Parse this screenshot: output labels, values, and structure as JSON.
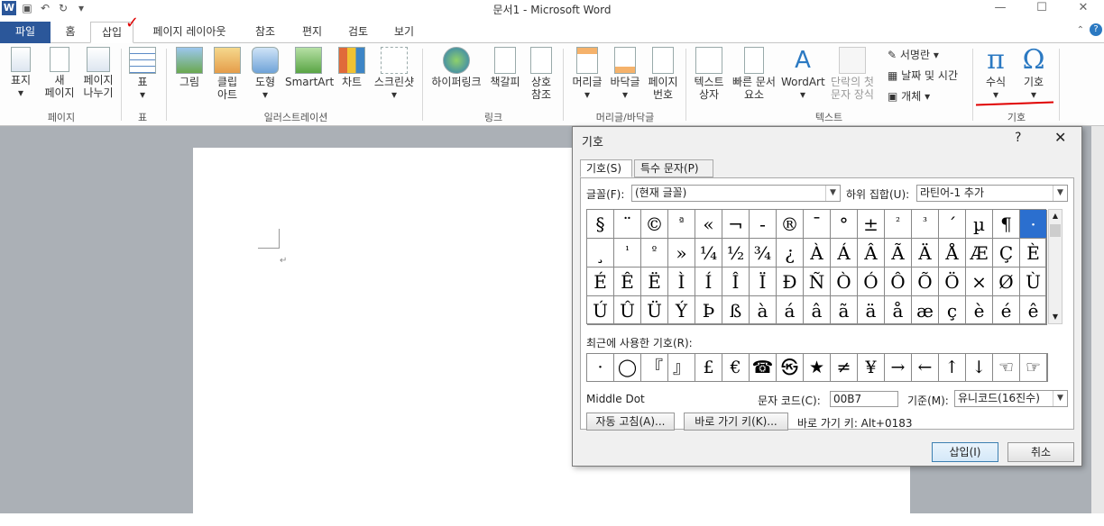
{
  "title": "문서1  -  Microsoft Word",
  "tabs": [
    "파일",
    "홈",
    "삽입",
    "페이지 레이아웃",
    "참조",
    "편지",
    "검토",
    "보기"
  ],
  "ribbon": {
    "btn_table": "표",
    "btn_page1": "표지",
    "btn_page2": "새",
    "btn_page2b": "페이지",
    "btn_page3": "페이지",
    "btn_page3b": "나누기",
    "btn_picture": "그림",
    "btn_clip": "클립",
    "btn_clipb": "아트",
    "btn_shapes": "도형",
    "btn_smartart": "SmartArt",
    "btn_chart": "차트",
    "btn_screenshot": "스크린샷",
    "btn_hyperlink": "하이퍼링크",
    "btn_bookmark": "책갈피",
    "btn_crossref": "상호",
    "btn_crossrefb": "참조",
    "btn_header": "머리글",
    "btn_footer": "바닥글",
    "btn_pagenum": "페이지",
    "btn_pagenumb": "번호",
    "btn_textbox": "텍스트",
    "btn_textboxb": "상자",
    "btn_quickparts": "빠른 문서",
    "btn_quickpartsb": "요소",
    "btn_wordart": "WordArt",
    "btn_dropcap": "단락의 첫",
    "btn_dropcapb": "문자 장식",
    "btn_signature": "서명란",
    "btn_datetime": "날짜 및 시간",
    "btn_object": "개체",
    "btn_equation": "수식",
    "btn_symbol": "기호",
    "groups": {
      "pages": "페이지",
      "tables": "표",
      "illustrations": "일러스트레이션",
      "links": "링크",
      "headerfooter": "머리글/바닥글",
      "text": "텍스트",
      "symbols": "기호"
    }
  },
  "dialog": {
    "title": "기호",
    "help": "?",
    "close": "✕",
    "tab_symbols": "기호(S)",
    "tab_special": "특수 문자(P)",
    "font_label": "글꼴(F):",
    "font_value": "(현재 글꼴)",
    "subset_label": "하위 집합(U):",
    "subset_value": "라틴어-1 추가",
    "grid_rows": [
      [
        "§",
        "¨",
        "©",
        "ª",
        "«",
        "¬",
        "-",
        "®",
        "¯",
        "°",
        "±",
        "²",
        "³",
        "´",
        "µ",
        "¶",
        "·"
      ],
      [
        "¸",
        "¹",
        "º",
        "»",
        "¼",
        "½",
        "¾",
        "¿",
        "À",
        "Á",
        "Â",
        "Ã",
        "Ä",
        "Å",
        "Æ",
        "Ç",
        "È"
      ],
      [
        "É",
        "Ê",
        "Ë",
        "Ì",
        "Í",
        "Î",
        "Ï",
        "Ð",
        "Ñ",
        "Ò",
        "Ó",
        "Ô",
        "Õ",
        "Ö",
        "×",
        "Ø",
        "Ù"
      ],
      [
        "Ú",
        "Û",
        "Ü",
        "Ý",
        "Þ",
        "ß",
        "à",
        "á",
        "â",
        "ã",
        "ä",
        "å",
        "æ",
        "ç",
        "è",
        "é",
        "ê"
      ]
    ],
    "recent_label": "최근에 사용한 기호(R):",
    "recent": [
      "·",
      "◯",
      "『",
      "』",
      "£",
      "€",
      "☎",
      "㉿",
      "★",
      "≠",
      "¥",
      "→",
      "←",
      "↑",
      "↓",
      "☜",
      "☞"
    ],
    "char_name": "Middle Dot",
    "code_label": "문자 코드(C):",
    "code_value": "00B7",
    "from_label": "기준(M):",
    "from_value": "유니코드(16진수)",
    "autocorrect": "자동 고침(A)...",
    "shortcut_key": "바로 가기 키(K)...",
    "shortcut_text": "바로 가기 키: Alt+0183",
    "insert": "삽입(I)",
    "cancel": "취소"
  }
}
